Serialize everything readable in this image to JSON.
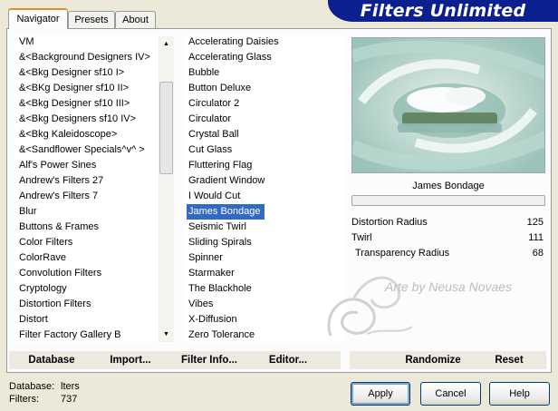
{
  "window": {
    "brand": "Filters Unlimited"
  },
  "tabs": [
    {
      "label": "Navigator",
      "active": true
    },
    {
      "label": "Presets",
      "active": false
    },
    {
      "label": "About",
      "active": false
    }
  ],
  "categories": [
    "VM",
    "&<Background Designers IV>",
    "&<Bkg Designer sf10 I>",
    "&<BKg Designer sf10 II>",
    "&<Bkg Designer sf10 III>",
    "&<Bkg Designers sf10 IV>",
    "&<Bkg Kaleidoscope>",
    "&<Sandflower Specials^v^ >",
    "Alf's Power Sines",
    "Andrew's Filters 27",
    "Andrew's Filters 7",
    "Blur",
    "Buttons & Frames",
    "Color Filters",
    "ColorRave",
    "Convolution Filters",
    "Cryptology",
    "Distortion Filters",
    "Distort",
    "Filter Factory Gallery B"
  ],
  "filters": [
    "Accelerating Daisies",
    "Accelerating Glass",
    "Bubble",
    "Button Deluxe",
    "Circulator 2",
    "Circulator",
    "Crystal Ball",
    "Cut Glass",
    "Fluttering Flag",
    "Gradient Window",
    "I Would Cut",
    "James Bondage",
    "Seismic Twirl",
    "Sliding Spirals",
    "Spinner",
    "Starmaker",
    "The Blackhole",
    "Vibes",
    "X-Diffusion",
    "Zero Tolerance"
  ],
  "selected_filter_index": 11,
  "selected_filter_name": "James Bondage",
  "params": [
    {
      "label": "Distortion Radius",
      "value": "125"
    },
    {
      "label": "Twirl",
      "value": "111"
    },
    {
      "label": "Transparency Radius",
      "value": "68"
    }
  ],
  "watermark": "Arte by Neusa Novaes",
  "left_buttons": {
    "database": "Database",
    "import": "Import...",
    "filter_info": "Filter Info...",
    "editor": "Editor..."
  },
  "right_buttons": {
    "randomize": "Randomize",
    "reset": "Reset"
  },
  "status": {
    "database_label": "Database:",
    "database_value": "lters",
    "filters_label": "Filters:",
    "filters_value": "737"
  },
  "dialog_buttons": {
    "apply": "Apply",
    "cancel": "Cancel",
    "help": "Help"
  },
  "colors": {
    "banner": "#0b1f8f",
    "selection": "#316ac5",
    "tab_accent": "#e68b2c"
  }
}
